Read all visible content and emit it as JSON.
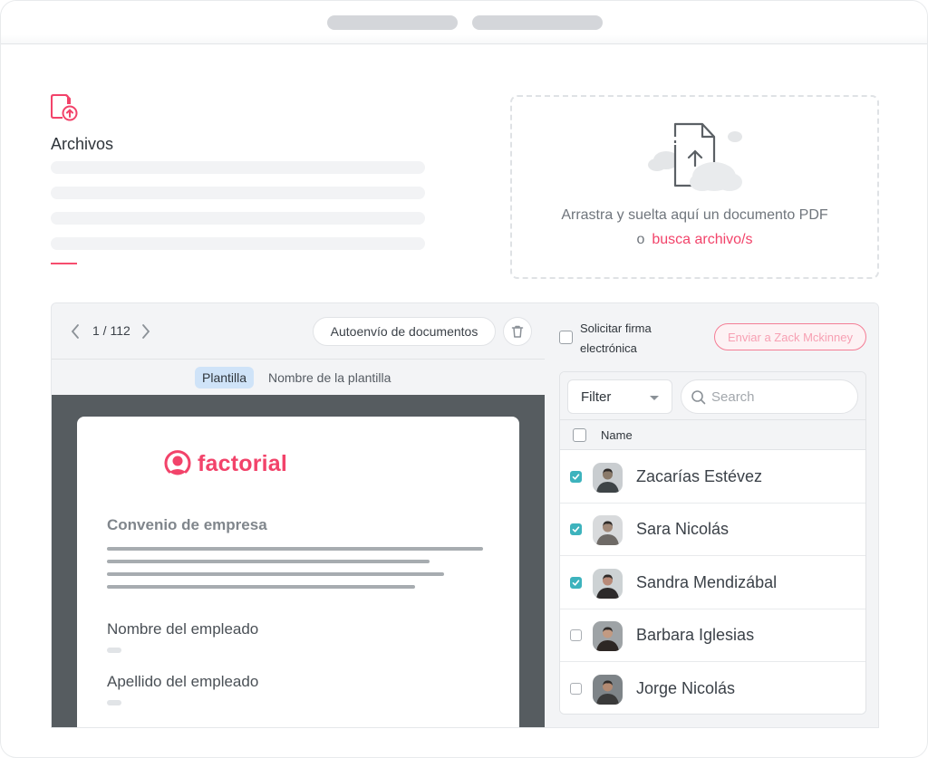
{
  "topbar": {
    "pills": [
      "",
      ""
    ]
  },
  "files": {
    "title": "Archivos",
    "icon": "file-upload-icon",
    "accent_color": "#f2436a"
  },
  "dropzone": {
    "icon": "document-upload-cloud-icon",
    "line1": "Arrastra y suelta aquí un documento PDF",
    "line2_prefix": "o",
    "link": "busca archivo/s"
  },
  "viewer": {
    "page_counter": "1 / 112",
    "prev_icon": "chevron-left-icon",
    "next_icon": "chevron-right-icon",
    "auto_send_label": "Autoenvío de documentos",
    "trash_icon": "trash-icon",
    "template_chip": "Plantilla",
    "template_name": "Nombre de la plantilla",
    "document": {
      "logo_text": "factorial",
      "heading": "Convenio de empresa",
      "field1_label": "Nombre del empleado",
      "field2_label": "Apellido del empleado"
    }
  },
  "sidebar": {
    "sign_label_line1": "Solicitar firma",
    "sign_label_line2": "electrónica",
    "sign_checked": false,
    "send_button": "Enviar a Zack Mckinney",
    "filter_label": "Filter",
    "search_placeholder": "Search",
    "column_name": "Name",
    "checkbox_color": "#3db3bd",
    "employees": [
      {
        "name": "Zacarías Estévez",
        "checked": true
      },
      {
        "name": "Sara Nicolás",
        "checked": true
      },
      {
        "name": "Sandra Mendizábal",
        "checked": true
      },
      {
        "name": "Barbara Iglesias",
        "checked": false
      },
      {
        "name": "Jorge Nicolás",
        "checked": false
      }
    ]
  }
}
